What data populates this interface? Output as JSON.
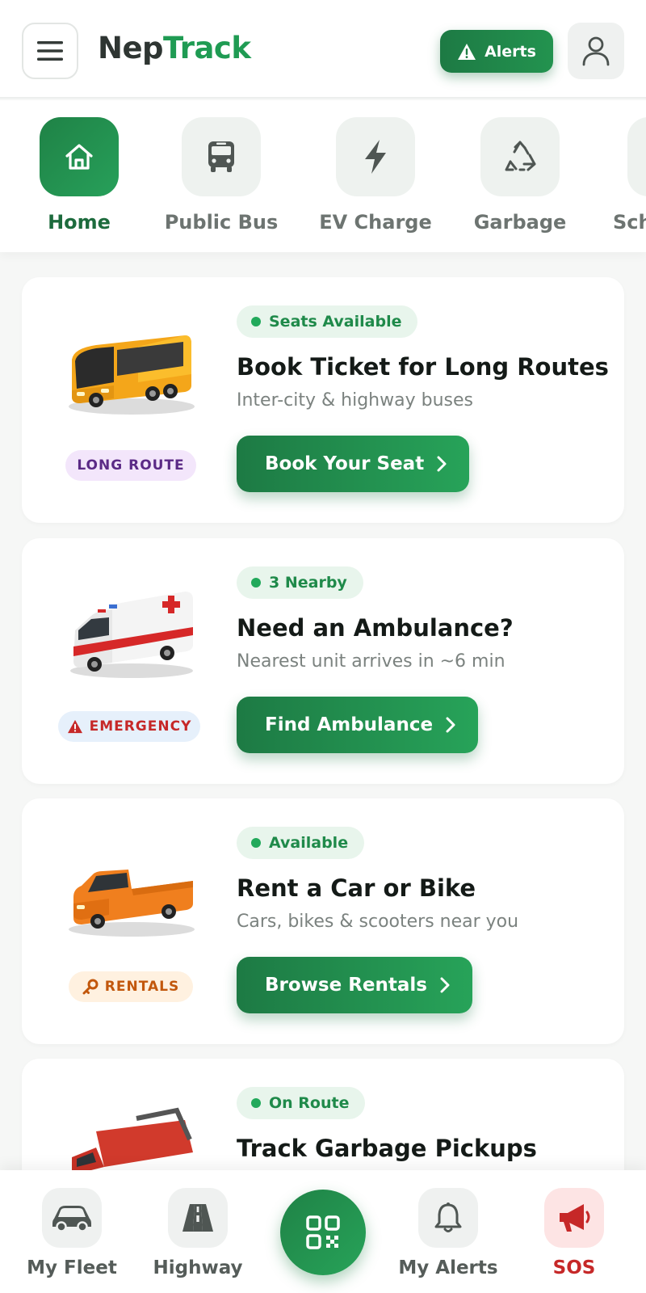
{
  "app": {
    "logo_part1": "Nep",
    "logo_part2": "Track",
    "alerts_label": "Alerts"
  },
  "categories": [
    {
      "label": "Home",
      "icon": "home-icon",
      "active": true
    },
    {
      "label": "Public Bus",
      "icon": "bus-icon"
    },
    {
      "label": "EV Charge",
      "icon": "lightning-icon"
    },
    {
      "label": "Garbage",
      "icon": "recycle-icon"
    },
    {
      "label": "Sch",
      "icon": "school-icon"
    }
  ],
  "cards": [
    {
      "status": "Seats Available",
      "title": "Book Ticket for Long Routes",
      "subtitle": "Inter-city & highway buses",
      "button": "Book Your Seat",
      "tag": "LONG ROUTE",
      "tag_color": "#5b2a86",
      "tag_bg": "#f3e6fb",
      "vehicle": "coach-bus-image"
    },
    {
      "status": "3 Nearby",
      "title": "Need an Ambulance?",
      "subtitle": "Nearest unit arrives in ~6 min",
      "button": "Find Ambulance",
      "tag": "EMERGENCY",
      "tag_color": "#c62828",
      "tag_bg": "#e6f0fb",
      "vehicle": "ambulance-image"
    },
    {
      "status": "Available",
      "title": "Rent a Car or Bike",
      "subtitle": "Cars, bikes & scooters near you",
      "button": "Browse Rentals",
      "tag": "RENTALS",
      "tag_color": "#c2570c",
      "tag_bg": "#fff1e0",
      "vehicle": "pickup-truck-image"
    },
    {
      "status": "On Route",
      "title": "Track Garbage Pickups",
      "vehicle": "garbage-truck-image"
    }
  ],
  "bottom_nav": [
    {
      "label": "My Fleet",
      "icon": "car-icon"
    },
    {
      "label": "Highway",
      "icon": "highway-icon"
    },
    {
      "label": "",
      "icon": "qr-scan-icon"
    },
    {
      "label": "My Alerts",
      "icon": "bell-icon"
    },
    {
      "label": "SOS",
      "icon": "megaphone-icon"
    }
  ],
  "colors": {
    "brand_green": "#1f9b53",
    "sos_red": "#c62828"
  }
}
